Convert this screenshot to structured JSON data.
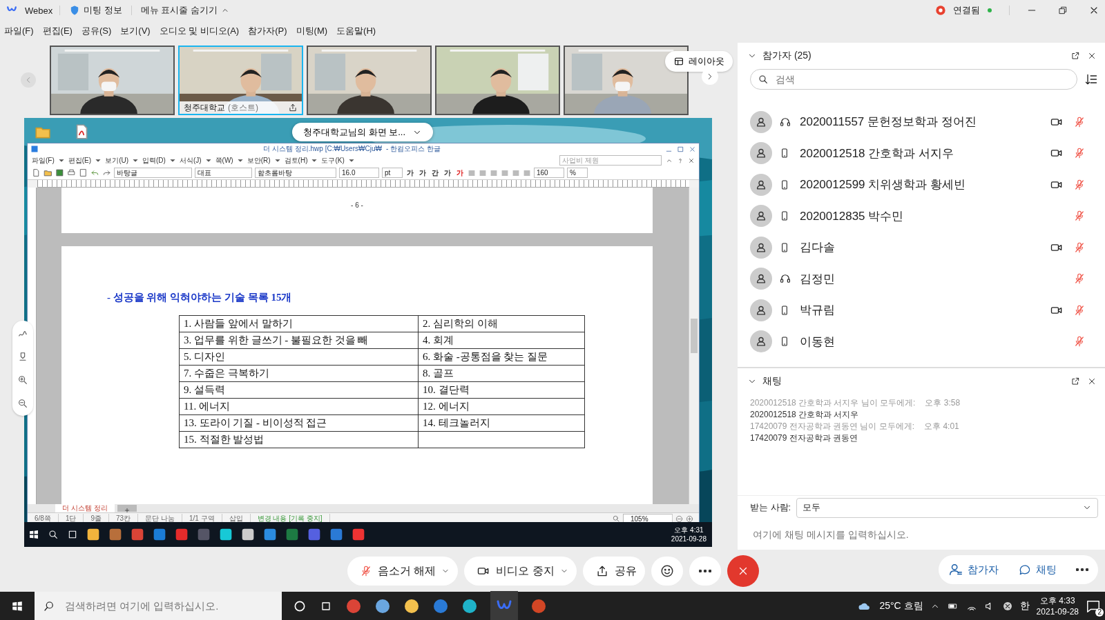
{
  "app": {
    "name": "Webex",
    "meeting_info": "미팅 정보",
    "hide_menu": "메뉴 표시줄 숨기기",
    "status": "연결됨"
  },
  "menu": [
    "파일(F)",
    "편집(E)",
    "공유(S)",
    "보기(V)",
    "오디오 및 비디오(A)",
    "참가자(P)",
    "미팅(M)",
    "도움말(H)"
  ],
  "videos": [
    {
      "selected": false
    },
    {
      "selected": true,
      "name": "청주대학교",
      "role": "(호스트)"
    },
    {
      "selected": false
    },
    {
      "selected": false
    },
    {
      "selected": false
    }
  ],
  "layout_button": "레이아웃",
  "share_banner": "청주대학교님의 화면 보...",
  "document": {
    "title": "더 시스템 정리.hwp [C:₩Users₩Cju₩",
    "app_name": "- 한컴오피스 한글",
    "menu": [
      "파일(F)",
      "편집(E)",
      "보기(U)",
      "입력(D)",
      "서식(J)",
      "쪽(W)",
      "보안(R)",
      "검토(H)",
      "도구(K)"
    ],
    "style_box": "사업비 제원",
    "toolbar": {
      "style": "바탕글",
      "lang": "대표",
      "font": "함초롬바탕",
      "size": "16.0",
      "unit": "pt",
      "zoom": "160",
      "zoom_unit": "%"
    },
    "format_buttons": [
      "가",
      "가",
      "간",
      "가",
      "가"
    ],
    "page_number": "- 6 -",
    "heading": "- 성공을 위해 익혀야하는 기술 목록 15개",
    "table": {
      "rows": [
        [
          "1.  사람들 앞에서 말하기",
          "2.  심리학의 이해"
        ],
        [
          "3.  업무를 위한 글쓰기 - 불필요한 것을 빼",
          "4.  회계"
        ],
        [
          "5.  디자인",
          "6.  화술 -공통점을 찾는 질문"
        ],
        [
          "7.  수줍은 극복하기",
          "8.  골프"
        ],
        [
          "9.  설득력",
          "10.  결단력"
        ],
        [
          "11.  에너지",
          "12.  에너지"
        ],
        [
          "13.  또라이 기질 - 비이성적 접근",
          "14.  테크놀러지"
        ],
        [
          "15.  적절한 발성법",
          ""
        ]
      ]
    },
    "sheet_tab": "더 시스템 정리",
    "status_bar": [
      "6/8쪽",
      "1단",
      "9줄",
      "73칸",
      "문단 나눔",
      "1/1 구역",
      "삽입",
      "변경 내용 [기록 중지]"
    ],
    "zoom": "105%"
  },
  "remote_clock": {
    "time": "오후 4:31",
    "date": "2021-09-28"
  },
  "participants": {
    "title": "참가자 (25)",
    "search_placeholder": "검색",
    "items": [
      {
        "name": "2020011557 문헌정보학과 정어진",
        "kind": "headset",
        "video": true,
        "muted": true
      },
      {
        "name": "2020012518 간호학과 서지우",
        "kind": "phone",
        "video": true,
        "muted": true
      },
      {
        "name": "2020012599 치위생학과 황세빈",
        "kind": "phone",
        "video": true,
        "muted": true
      },
      {
        "name": "2020012835 박수민",
        "kind": "phone",
        "video": false,
        "muted": true
      },
      {
        "name": "김다솔",
        "kind": "phone",
        "video": true,
        "muted": true
      },
      {
        "name": "김정민",
        "kind": "headset",
        "video": false,
        "muted": true
      },
      {
        "name": "박규림",
        "kind": "phone",
        "video": true,
        "muted": true
      },
      {
        "name": "이동현",
        "kind": "phone",
        "video": false,
        "muted": true
      }
    ]
  },
  "chat": {
    "title": "채팅",
    "messages": [
      {
        "sender": "2020012518 간호학과 서지우 님이 모두에게:",
        "time": "오후 3:58",
        "text": "2020012518 간호학과 서지우"
      },
      {
        "sender": "17420079 전자공학과 권동연 님이 모두에게:",
        "time": "오후 4:01",
        "text": "17420079 전자공학과 권동연"
      }
    ],
    "recipient_label": "받는 사람:",
    "recipient": "모두",
    "placeholder": "여기에 채팅 메시지를 입력하십시오."
  },
  "controls": [
    {
      "kind": "mute",
      "label": "음소거 해제"
    },
    {
      "kind": "video",
      "label": "비디오 중지"
    },
    {
      "kind": "share",
      "label": "공유"
    }
  ],
  "panel_buttons": [
    {
      "kind": "participants",
      "label": "참가자"
    },
    {
      "kind": "chat",
      "label": "채팅"
    }
  ],
  "taskbar": {
    "search_placeholder": "검색하려면 여기에 입력하십시오.",
    "weather": "25°C 흐림",
    "ime": "한",
    "time": "오후 4:33",
    "date": "2021-09-28",
    "notifications": "2"
  }
}
